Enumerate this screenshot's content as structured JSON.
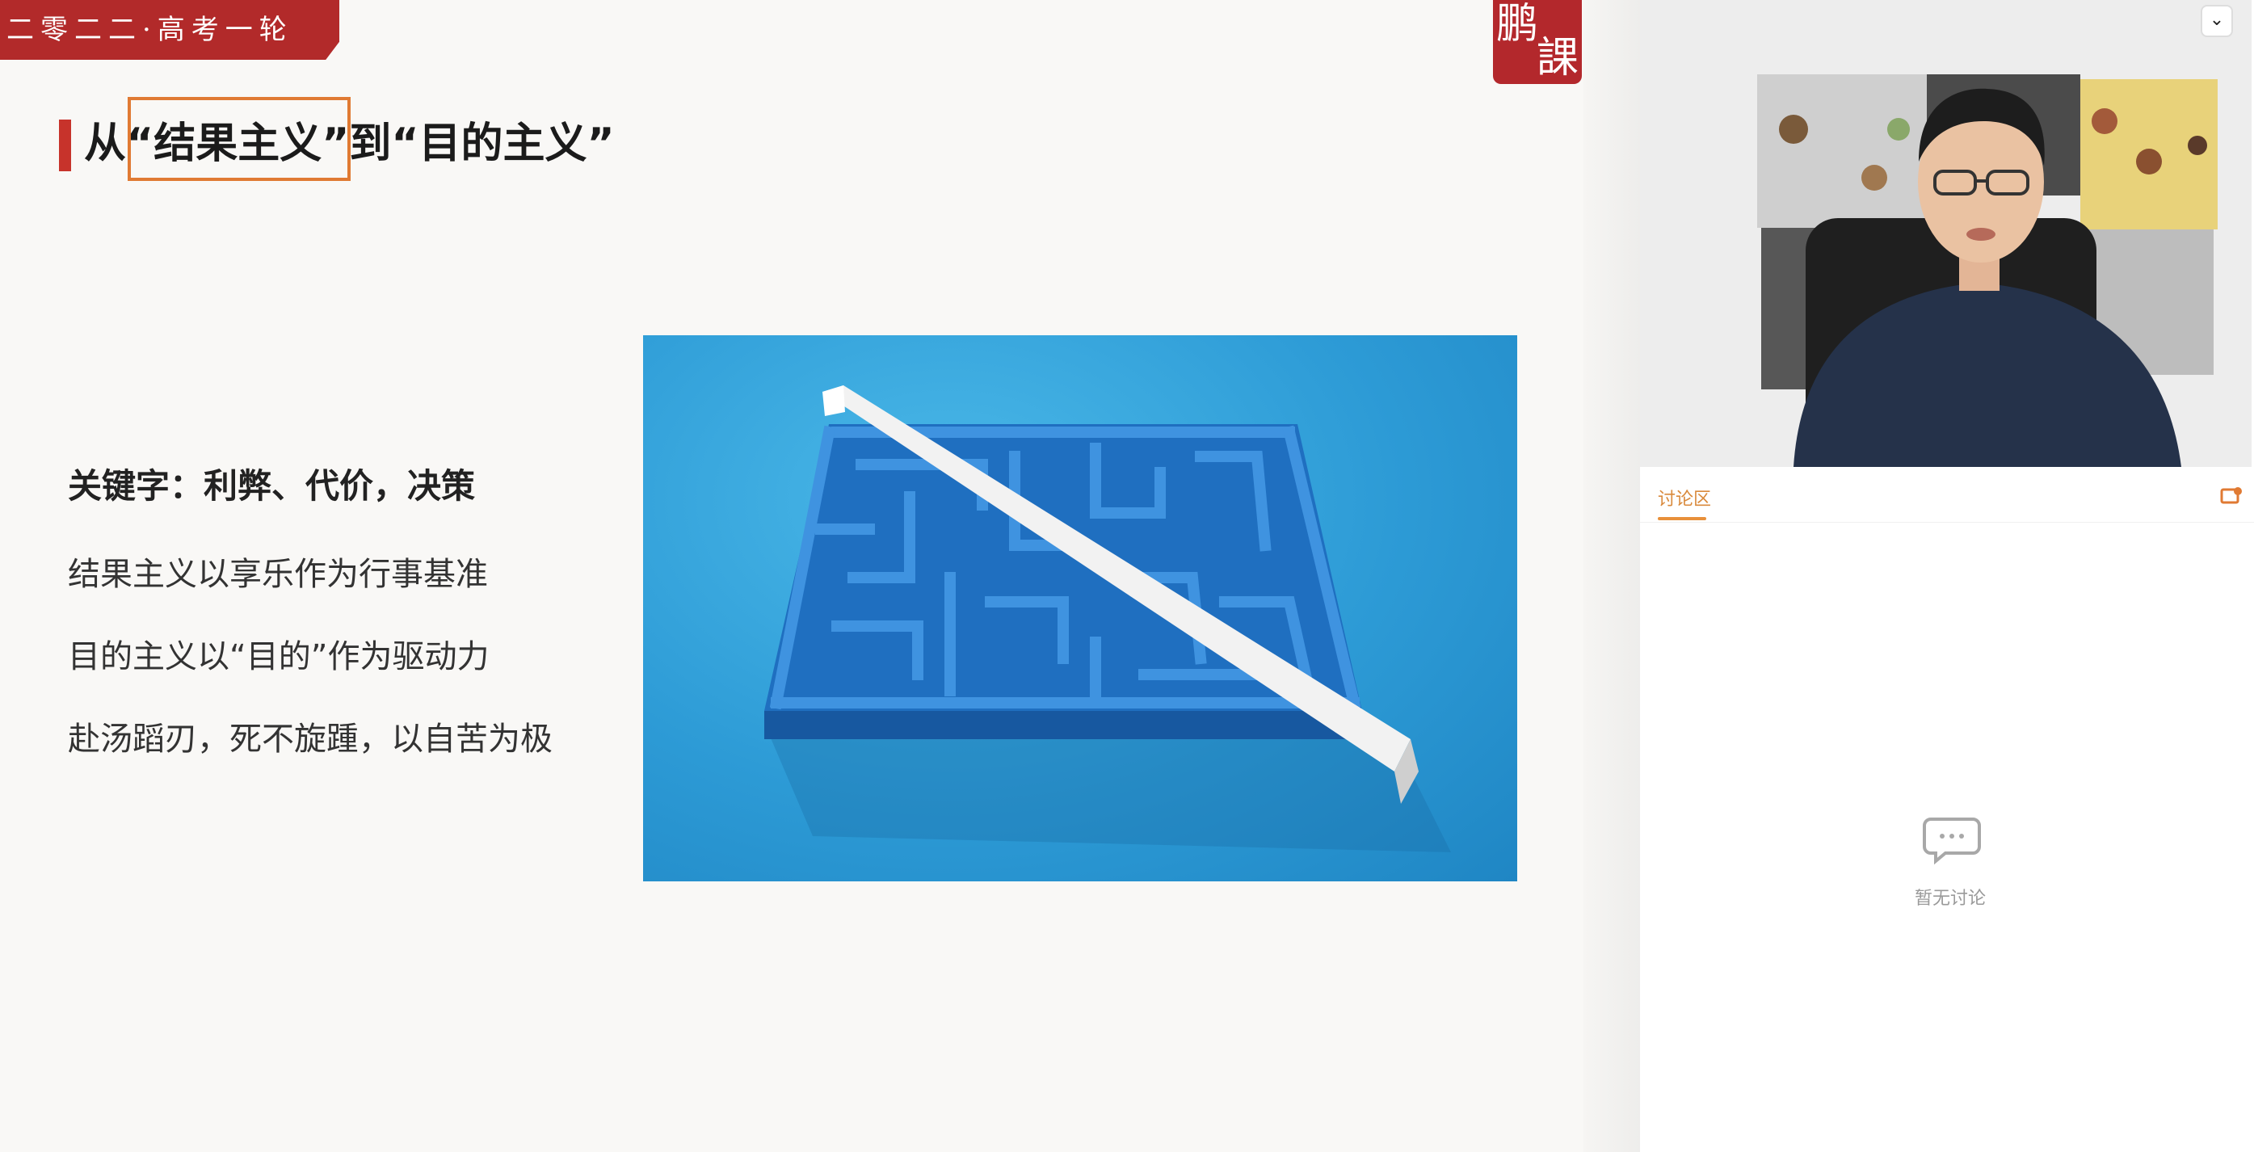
{
  "banner": {
    "text": "二零二二·高考一轮"
  },
  "logo": {
    "char1": "鹏",
    "char2": "課"
  },
  "slide": {
    "title_before": "从",
    "title_highlight": "“结果主义”",
    "title_after": "到“目的主义”",
    "keyword_line": "关键字：利弊、代价，决策",
    "lines": [
      "结果主义以享乐作为行事基准",
      "目的主义以“目的”作为驱动力",
      "赴汤蹈刃，死不旋踵，以自苦为极"
    ]
  },
  "side_panel": {
    "tab_label": "讨论区",
    "empty_text": "暂无讨论"
  },
  "colors": {
    "brand_red": "#b22a2a",
    "accent_orange": "#e8903a",
    "maze_blue": "#2d9bd6"
  },
  "icons": [
    "chevron-down-icon",
    "chat-bubble-icon",
    "expand-icon"
  ]
}
